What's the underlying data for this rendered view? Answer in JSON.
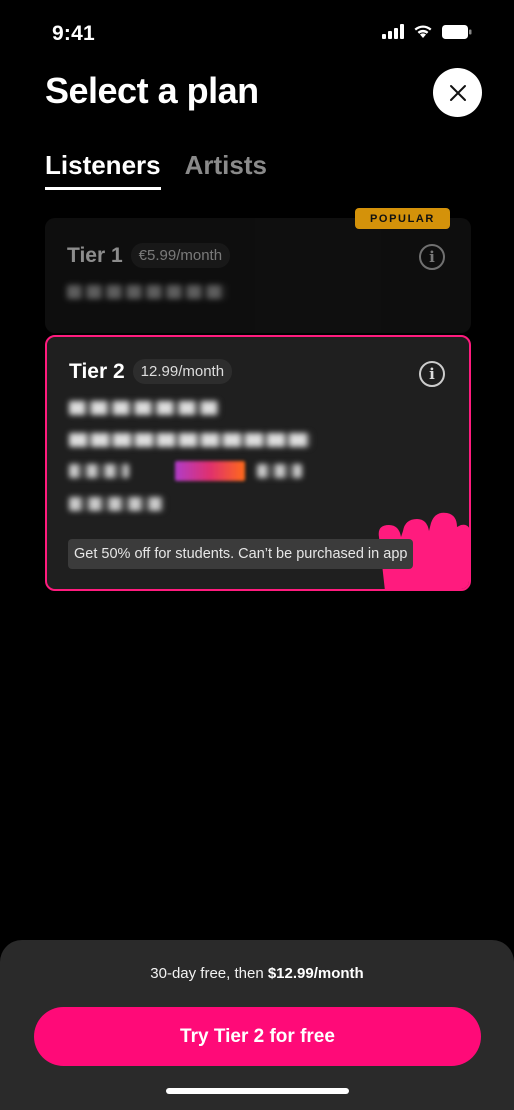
{
  "status_bar": {
    "time": "9:41",
    "icons": [
      "signal-icon",
      "wifi-icon",
      "battery-icon"
    ]
  },
  "header": {
    "title": "Select a plan",
    "close_icon": "close-icon"
  },
  "tabs": [
    {
      "label": "Listeners",
      "active": true
    },
    {
      "label": "Artists",
      "active": false
    }
  ],
  "plans": [
    {
      "name": "Tier 1",
      "price": "€5.99/month",
      "badge": "POPULAR",
      "selected": false,
      "info_icon": "info-icon"
    },
    {
      "name": "Tier 2",
      "price": "12.99/month",
      "selected": true,
      "info_icon": "info-icon",
      "note": "Get 50% off for students. Can’t be purchased in app"
    }
  ],
  "footer": {
    "trial_prefix": "30-day free, then ",
    "trial_price": "$12.99/month",
    "cta_label": "Try Tier 2 for free"
  },
  "colors": {
    "accent": "#ff0a78",
    "badge": "#d4920a",
    "background": "#000000",
    "sheet": "#2a2a2a"
  }
}
